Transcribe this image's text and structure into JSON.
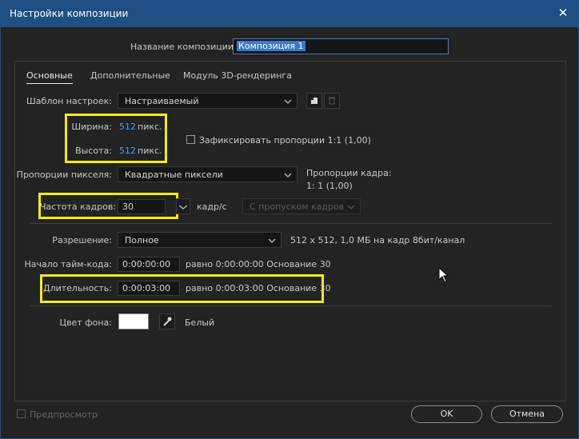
{
  "window": {
    "title": "Настройки композиции"
  },
  "name_row": {
    "label": "Название композиции:",
    "value": "Композиция 1"
  },
  "tabs": [
    {
      "label": "Основные",
      "active": true
    },
    {
      "label": "Дополнительные",
      "active": false
    },
    {
      "label": "Модуль 3D-рендеринга",
      "active": false
    }
  ],
  "preset": {
    "label": "Шаблон настроек:",
    "value": "Настраиваемый"
  },
  "width": {
    "label": "Ширина:",
    "value": "512",
    "unit": "пикс."
  },
  "height": {
    "label": "Высота:",
    "value": "512",
    "unit": "пикс."
  },
  "lock_aspect": {
    "label": "Зафиксировать пропорции 1:1 (1,00)",
    "checked": false
  },
  "pixel_aspect": {
    "label": "Пропорции пикселя:",
    "value": "Квадратные пиксели"
  },
  "frame_aspect": {
    "label": "Пропорции кадра:",
    "value": "1: 1 (1,00)"
  },
  "frame_rate": {
    "label": "Частота кадров:",
    "value": "30",
    "unit": "кадр/с",
    "drop_frame": "С пропуском кадров"
  },
  "resolution": {
    "label": "Разрешение:",
    "value": "Полное",
    "info": "512 x 512, 1,0 МБ на кадр 8бит/канал"
  },
  "start_timecode": {
    "label": "Начало тайм-кода:",
    "value": "0:00:00:00",
    "info": "равно 0:00:00:00  Основание 30"
  },
  "duration": {
    "label": "Длительность:",
    "value": "0:00:03:00",
    "info": "равно 0:00:03:00  Основание 30"
  },
  "background": {
    "label": "Цвет фона:",
    "color": "#ffffff",
    "name": "Белый"
  },
  "preview": {
    "label": "Предпросмотр",
    "checked": false
  },
  "buttons": {
    "ok": "OK",
    "cancel": "Отмена"
  },
  "colors": {
    "titlebar": "#1f4f82",
    "highlight": "#f2ec16",
    "accent_number": "#4ea0f0"
  }
}
